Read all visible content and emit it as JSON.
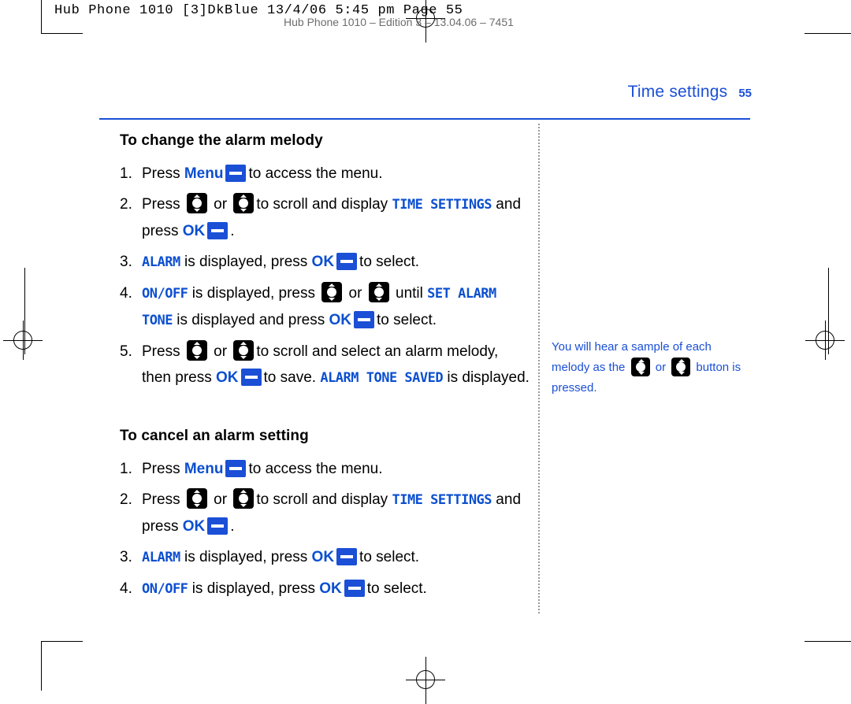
{
  "slug": "Hub Phone 1010 [3]DkBlue  13/4/06  5:45 pm  Page 55",
  "ghost_line": "Hub Phone 1010 – Edition 3 – 13.04.06 – 7451",
  "running_head": {
    "title": "Time settings",
    "page": "55"
  },
  "colors": {
    "accent": "#1a4fd6",
    "lcd": "#0b4fd0",
    "key": "#1a4fd6",
    "nav": "#000000"
  },
  "sections": [
    {
      "heading": "To change the alarm melody",
      "steps": [
        {
          "num": "1.",
          "parts": [
            {
              "t": "text",
              "v": "Press "
            },
            {
              "t": "bold",
              "v": "Menu"
            },
            {
              "t": "key",
              "v": "menu-key"
            },
            {
              "t": "text",
              "v": "to access the menu."
            }
          ]
        },
        {
          "num": "2.",
          "parts": [
            {
              "t": "text",
              "v": "Press "
            },
            {
              "t": "nav",
              "v": "nav-up-down-key"
            },
            {
              "t": "text",
              "v": " or "
            },
            {
              "t": "nav",
              "v": "nav-up-down-key"
            },
            {
              "t": "text",
              "v": "to scroll and display "
            },
            {
              "t": "lcd",
              "v": "TIME SETTINGS"
            },
            {
              "t": "text",
              "v": " and press "
            },
            {
              "t": "bold",
              "v": "OK"
            },
            {
              "t": "key",
              "v": "ok-key"
            },
            {
              "t": "text",
              "v": "."
            }
          ]
        },
        {
          "num": "3.",
          "parts": [
            {
              "t": "lcd",
              "v": "ALARM"
            },
            {
              "t": "text",
              "v": " is displayed, press "
            },
            {
              "t": "bold",
              "v": "OK"
            },
            {
              "t": "key",
              "v": "ok-key"
            },
            {
              "t": "text",
              "v": "to select."
            }
          ]
        },
        {
          "num": "4.",
          "parts": [
            {
              "t": "lcd",
              "v": "ON/OFF"
            },
            {
              "t": "text",
              "v": " is displayed, press "
            },
            {
              "t": "nav",
              "v": "nav-up-down-key"
            },
            {
              "t": "text",
              "v": " or "
            },
            {
              "t": "nav",
              "v": "nav-up-down-key"
            },
            {
              "t": "text",
              "v": " until "
            },
            {
              "t": "lcd",
              "v": "SET ALARM TONE"
            },
            {
              "t": "text",
              "v": " is displayed and press "
            },
            {
              "t": "bold",
              "v": "OK"
            },
            {
              "t": "key",
              "v": "ok-key"
            },
            {
              "t": "text",
              "v": "to select."
            }
          ]
        },
        {
          "num": "5.",
          "parts": [
            {
              "t": "text",
              "v": "Press "
            },
            {
              "t": "nav",
              "v": "nav-up-down-key"
            },
            {
              "t": "text",
              "v": " or "
            },
            {
              "t": "nav",
              "v": "nav-up-down-key"
            },
            {
              "t": "text",
              "v": "to scroll and select an alarm melody, then press "
            },
            {
              "t": "bold",
              "v": "OK"
            },
            {
              "t": "key",
              "v": "ok-key"
            },
            {
              "t": "text",
              "v": "to save. "
            },
            {
              "t": "lcd",
              "v": "ALARM TONE SAVED"
            },
            {
              "t": "text",
              "v": " is displayed."
            }
          ]
        }
      ]
    },
    {
      "heading": "To cancel an alarm setting",
      "steps": [
        {
          "num": "1.",
          "parts": [
            {
              "t": "text",
              "v": "Press "
            },
            {
              "t": "bold",
              "v": "Menu"
            },
            {
              "t": "key",
              "v": "menu-key"
            },
            {
              "t": "text",
              "v": "to access the menu."
            }
          ]
        },
        {
          "num": "2.",
          "parts": [
            {
              "t": "text",
              "v": "Press "
            },
            {
              "t": "nav",
              "v": "nav-up-down-key"
            },
            {
              "t": "text",
              "v": " or "
            },
            {
              "t": "nav",
              "v": "nav-up-down-key"
            },
            {
              "t": "text",
              "v": "to scroll and display "
            },
            {
              "t": "lcd",
              "v": "TIME SETTINGS"
            },
            {
              "t": "text",
              "v": " and press "
            },
            {
              "t": "bold",
              "v": "OK"
            },
            {
              "t": "key",
              "v": "ok-key"
            },
            {
              "t": "text",
              "v": "."
            }
          ]
        },
        {
          "num": "3.",
          "parts": [
            {
              "t": "lcd",
              "v": "ALARM"
            },
            {
              "t": "text",
              "v": " is displayed, press "
            },
            {
              "t": "bold",
              "v": "OK"
            },
            {
              "t": "key",
              "v": "ok-key"
            },
            {
              "t": "text",
              "v": "to select."
            }
          ]
        },
        {
          "num": "4.",
          "parts": [
            {
              "t": "lcd",
              "v": "ON/OFF"
            },
            {
              "t": "text",
              "v": " is displayed, press "
            },
            {
              "t": "bold",
              "v": "OK"
            },
            {
              "t": "key",
              "v": "ok-key"
            },
            {
              "t": "text",
              "v": "to select."
            }
          ]
        }
      ]
    }
  ],
  "side_note": {
    "before": "You will hear a sample of each melody as the",
    "middle": " or ",
    "after": "button is pressed."
  }
}
